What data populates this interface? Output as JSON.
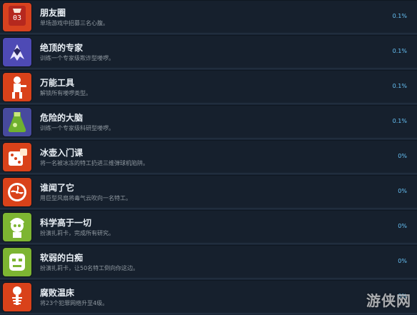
{
  "achievements": [
    {
      "title": "朋友圈",
      "description": "单场游戏中招募三名心腹。",
      "percent": "0.1%",
      "icon": "badge-03-icon"
    },
    {
      "title": "绝顶的专家",
      "description": "训练一个专家级欺诈型喽啰。",
      "percent": "0.1%",
      "icon": "purple-cloak-icon"
    },
    {
      "title": "万能工具",
      "description": "解锁所有喽啰类型。",
      "percent": "0.1%",
      "icon": "worker-minion-icon"
    },
    {
      "title": "危险的大脑",
      "description": "训练一个专家级科研型喽啰。",
      "percent": "0.1%",
      "icon": "flask-icon"
    },
    {
      "title": "冰壶入门课",
      "description": "将一名被冰冻的特工扔进三维弹球机陷阱。",
      "percent": "0%",
      "icon": "dice-icon"
    },
    {
      "title": "谁闻了它",
      "description": "用巨型风扇将毒气云吹向一名特工。",
      "percent": "0%",
      "icon": "fan-icon"
    },
    {
      "title": "科学高于一切",
      "description": "扮演扎莉卡，完成所有研究。",
      "percent": "0%",
      "icon": "scientist-icon"
    },
    {
      "title": "软弱的白痴",
      "description": "扮演扎莉卡，让50名特工倒向你这边。",
      "percent": "0%",
      "icon": "zombie-face-icon"
    },
    {
      "title": "腐败温床",
      "description": "将23个犯罪网络升至4级。",
      "percent": "0%",
      "icon": "skeleton-icon"
    }
  ],
  "watermark": "游侠网"
}
